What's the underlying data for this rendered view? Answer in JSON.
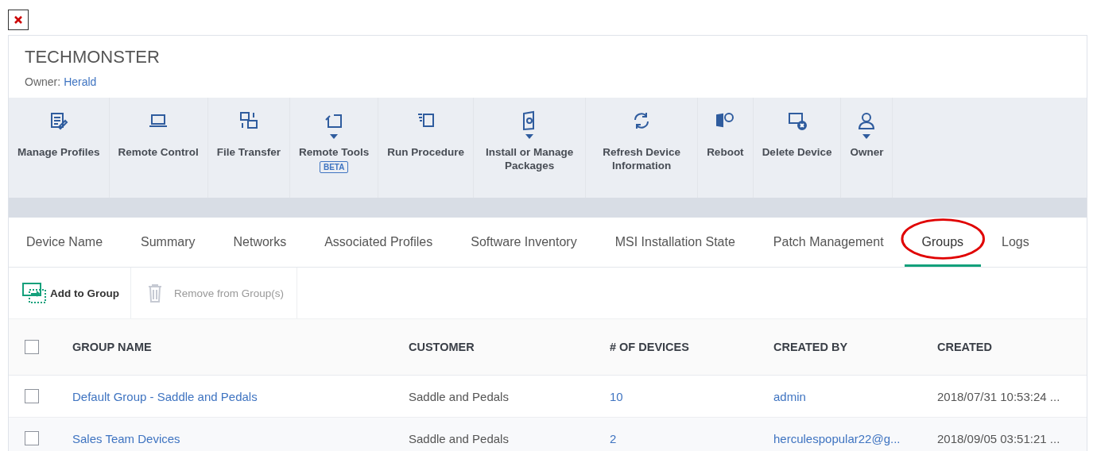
{
  "device": {
    "name": "TECHMONSTER",
    "owner_label": "Owner:",
    "owner": "Herald"
  },
  "toolbar": [
    {
      "label": "Manage Profiles",
      "has_menu": false
    },
    {
      "label": "Remote Control",
      "has_menu": false
    },
    {
      "label": "File Transfer",
      "has_menu": false
    },
    {
      "label": "Remote Tools",
      "has_menu": true,
      "badge": "BETA"
    },
    {
      "label": "Run Procedure",
      "has_menu": false
    },
    {
      "label": "Install or Manage Packages",
      "has_menu": true
    },
    {
      "label": "Refresh Device Information",
      "has_menu": false
    },
    {
      "label": "Reboot",
      "has_menu": false
    },
    {
      "label": "Delete Device",
      "has_menu": false
    },
    {
      "label": "Owner",
      "has_menu": true
    }
  ],
  "tabs": [
    {
      "label": "Device Name",
      "selected": false,
      "circled": false
    },
    {
      "label": "Summary",
      "selected": false,
      "circled": false
    },
    {
      "label": "Networks",
      "selected": false,
      "circled": false
    },
    {
      "label": "Associated Profiles",
      "selected": false,
      "circled": false
    },
    {
      "label": "Software Inventory",
      "selected": false,
      "circled": false
    },
    {
      "label": "MSI Installation State",
      "selected": false,
      "circled": false
    },
    {
      "label": "Patch Management",
      "selected": false,
      "circled": false
    },
    {
      "label": "Groups",
      "selected": true,
      "circled": true
    },
    {
      "label": "Logs",
      "selected": false,
      "circled": false
    }
  ],
  "actions": [
    {
      "label": "Add to Group",
      "disabled": false
    },
    {
      "label": "Remove from Group(s)",
      "disabled": true
    }
  ],
  "table": {
    "header_checked": false,
    "columns": [
      "GROUP NAME",
      "CUSTOMER",
      "# OF DEVICES",
      "CREATED BY",
      "CREATED"
    ],
    "rows": [
      {
        "checked": false,
        "cells": [
          "Default Group - Saddle and Pedals",
          "Saddle and Pedals",
          "10",
          "admin",
          "2018/07/31 10:53:24 ..."
        ]
      },
      {
        "checked": false,
        "cells": [
          "Sales Team Devices",
          "Saddle and Pedals",
          "2",
          "herculespopular22@g...",
          "2018/09/05 03:51:21 ..."
        ]
      }
    ]
  }
}
